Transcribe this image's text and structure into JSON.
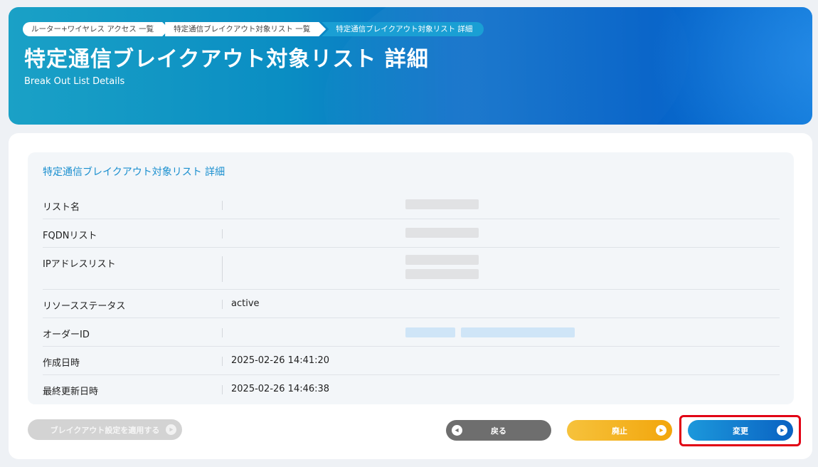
{
  "breadcrumb": [
    "ルーター+ワイヤレス アクセス 一覧",
    "特定通信ブレイクアウト対象リスト 一覧",
    "特定通信ブレイクアウト対象リスト 詳細"
  ],
  "header": {
    "title": "特定通信ブレイクアウト対象リスト 詳細",
    "subtitle": "Break Out List Details"
  },
  "panel": {
    "title": "特定通信ブレイクアウト対象リスト 詳細",
    "rows": {
      "list_name": {
        "label": "リスト名",
        "value": ""
      },
      "fqdn_list": {
        "label": "FQDNリスト",
        "value": ""
      },
      "ip_list": {
        "label": "IPアドレスリスト",
        "value": ""
      },
      "resource_status": {
        "label": "リソースステータス",
        "value": "active"
      },
      "order_id": {
        "label": "オーダーID",
        "value": ""
      },
      "created_at": {
        "label": "作成日時",
        "value": "2025-02-26 14:41:20"
      },
      "updated_at": {
        "label": "最終更新日時",
        "value": "2025-02-26 14:46:38"
      }
    }
  },
  "buttons": {
    "apply": "ブレイクアウト設定を適用する",
    "back": "戻る",
    "abolish": "廃止",
    "change": "変更"
  },
  "colors": {
    "accent": "#1a8fcf",
    "highlight": "#e10014",
    "abolish": "#f2a60c",
    "change": "#0a62c2",
    "back": "#6e6e6e"
  }
}
